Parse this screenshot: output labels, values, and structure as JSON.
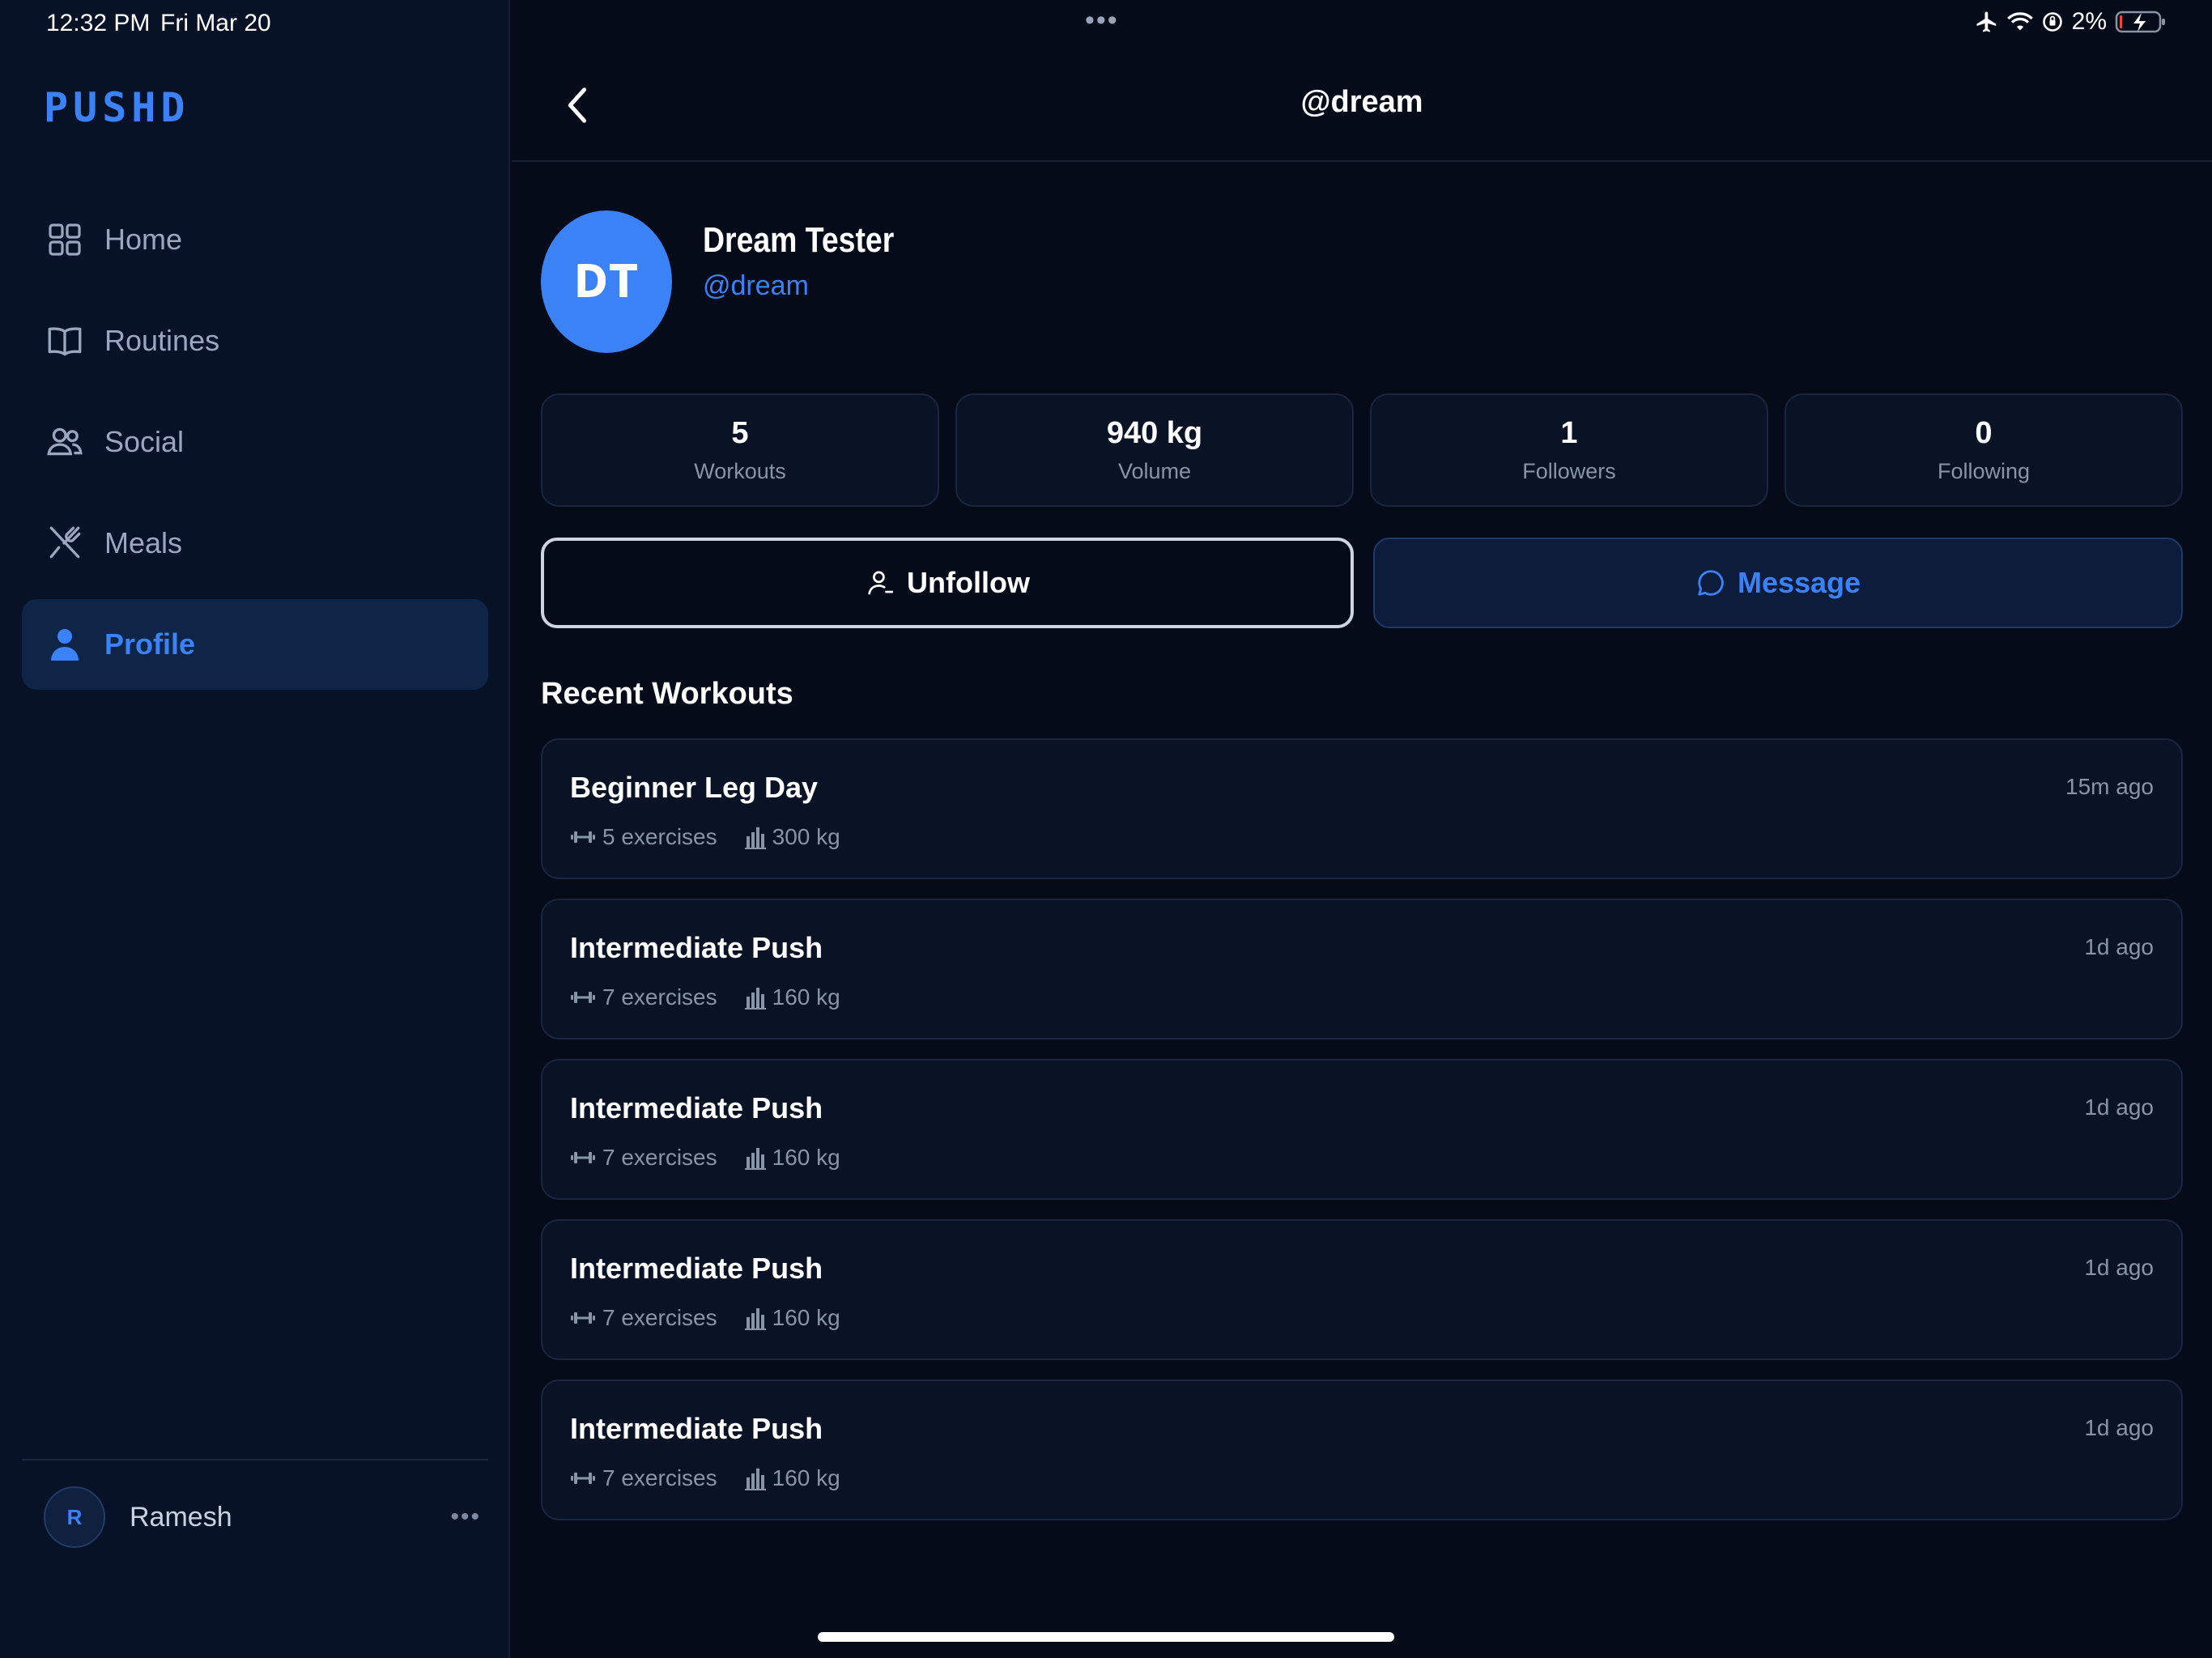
{
  "status_bar": {
    "time": "12:32 PM",
    "date": "Fri Mar 20",
    "battery": "2%"
  },
  "sidebar": {
    "logo": "PUSHD",
    "items": [
      {
        "label": "Home",
        "icon": "grid-icon",
        "active": false
      },
      {
        "label": "Routines",
        "icon": "book-icon",
        "active": false
      },
      {
        "label": "Social",
        "icon": "users-icon",
        "active": false
      },
      {
        "label": "Meals",
        "icon": "utensils-icon",
        "active": false
      },
      {
        "label": "Profile",
        "icon": "person-icon",
        "active": true
      }
    ],
    "user": {
      "initial": "R",
      "name": "Ramesh"
    }
  },
  "header": {
    "title": "@dream"
  },
  "profile": {
    "initials": "DT",
    "name": "Dream Tester",
    "handle": "@dream"
  },
  "stats": [
    {
      "value": "5",
      "label": "Workouts"
    },
    {
      "value": "940 kg",
      "label": "Volume"
    },
    {
      "value": "1",
      "label": "Followers"
    },
    {
      "value": "0",
      "label": "Following"
    }
  ],
  "actions": {
    "unfollow_label": "Unfollow",
    "message_label": "Message"
  },
  "recent": {
    "title": "Recent Workouts",
    "items": [
      {
        "name": "Beginner Leg Day",
        "time": "15m ago",
        "exercises": "5 exercises",
        "volume": "300 kg"
      },
      {
        "name": "Intermediate Push",
        "time": "1d ago",
        "exercises": "7 exercises",
        "volume": "160 kg"
      },
      {
        "name": "Intermediate Push",
        "time": "1d ago",
        "exercises": "7 exercises",
        "volume": "160 kg"
      },
      {
        "name": "Intermediate Push",
        "time": "1d ago",
        "exercises": "7 exercises",
        "volume": "160 kg"
      },
      {
        "name": "Intermediate Push",
        "time": "1d ago",
        "exercises": "7 exercises",
        "volume": "160 kg"
      }
    ]
  },
  "colors": {
    "accent": "#3b82f6",
    "background": "#050b18",
    "sidebar": "#081226",
    "card": "#0a1326"
  }
}
